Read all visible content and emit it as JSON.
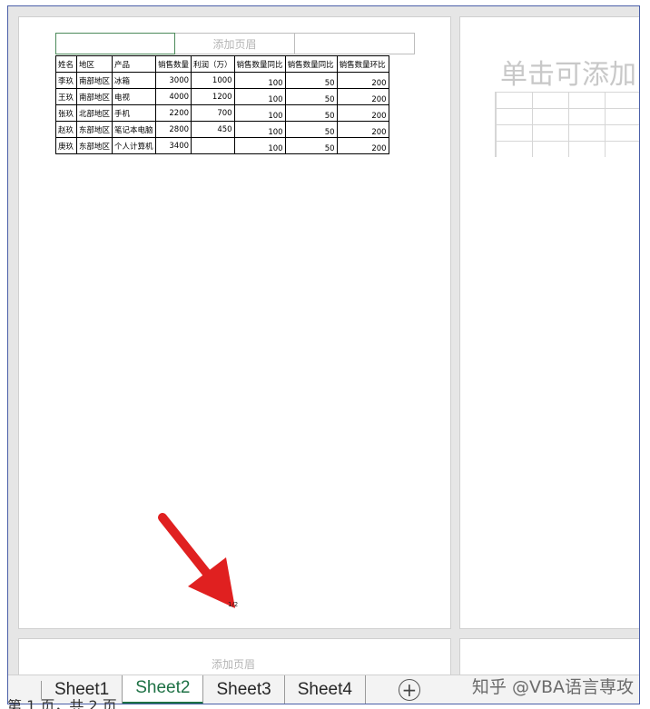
{
  "page_layout": {
    "header_placeholder": "添加页眉",
    "footer_placeholder": "添加页眉",
    "page_number": "1/2",
    "right_page_hint": "单击可添加"
  },
  "table": {
    "headers": [
      "姓名",
      "地区",
      "产品",
      "销售数量",
      "利润（万）",
      "销售数量同比",
      "销售数量同比",
      "销售数量环比"
    ],
    "rows": [
      [
        "李玖",
        "南部地区",
        "冰箱",
        "3000",
        "1000",
        "100",
        "50",
        "200"
      ],
      [
        "王玖",
        "南部地区",
        "电视",
        "4000",
        "1200",
        "100",
        "50",
        "200"
      ],
      [
        "张玖",
        "北部地区",
        "手机",
        "2200",
        "700",
        "100",
        "50",
        "200"
      ],
      [
        "赵玖",
        "东部地区",
        "笔记本电脑",
        "2800",
        "450",
        "100",
        "50",
        "200"
      ],
      [
        "庚玖",
        "东部地区",
        "个人计算机",
        "3400",
        "",
        "100",
        "50",
        "200"
      ]
    ]
  },
  "tabs": {
    "sheet1": "Sheet1",
    "sheet2": "Sheet2",
    "sheet3": "Sheet3",
    "sheet4": "Sheet4",
    "add_icon": "plus-circle-icon"
  },
  "watermark": "知乎 @VBA语言専攻",
  "status": "第 1 页，共 2 页",
  "colors": {
    "active_tab": "#1e7145",
    "arrow": "#e02020"
  }
}
